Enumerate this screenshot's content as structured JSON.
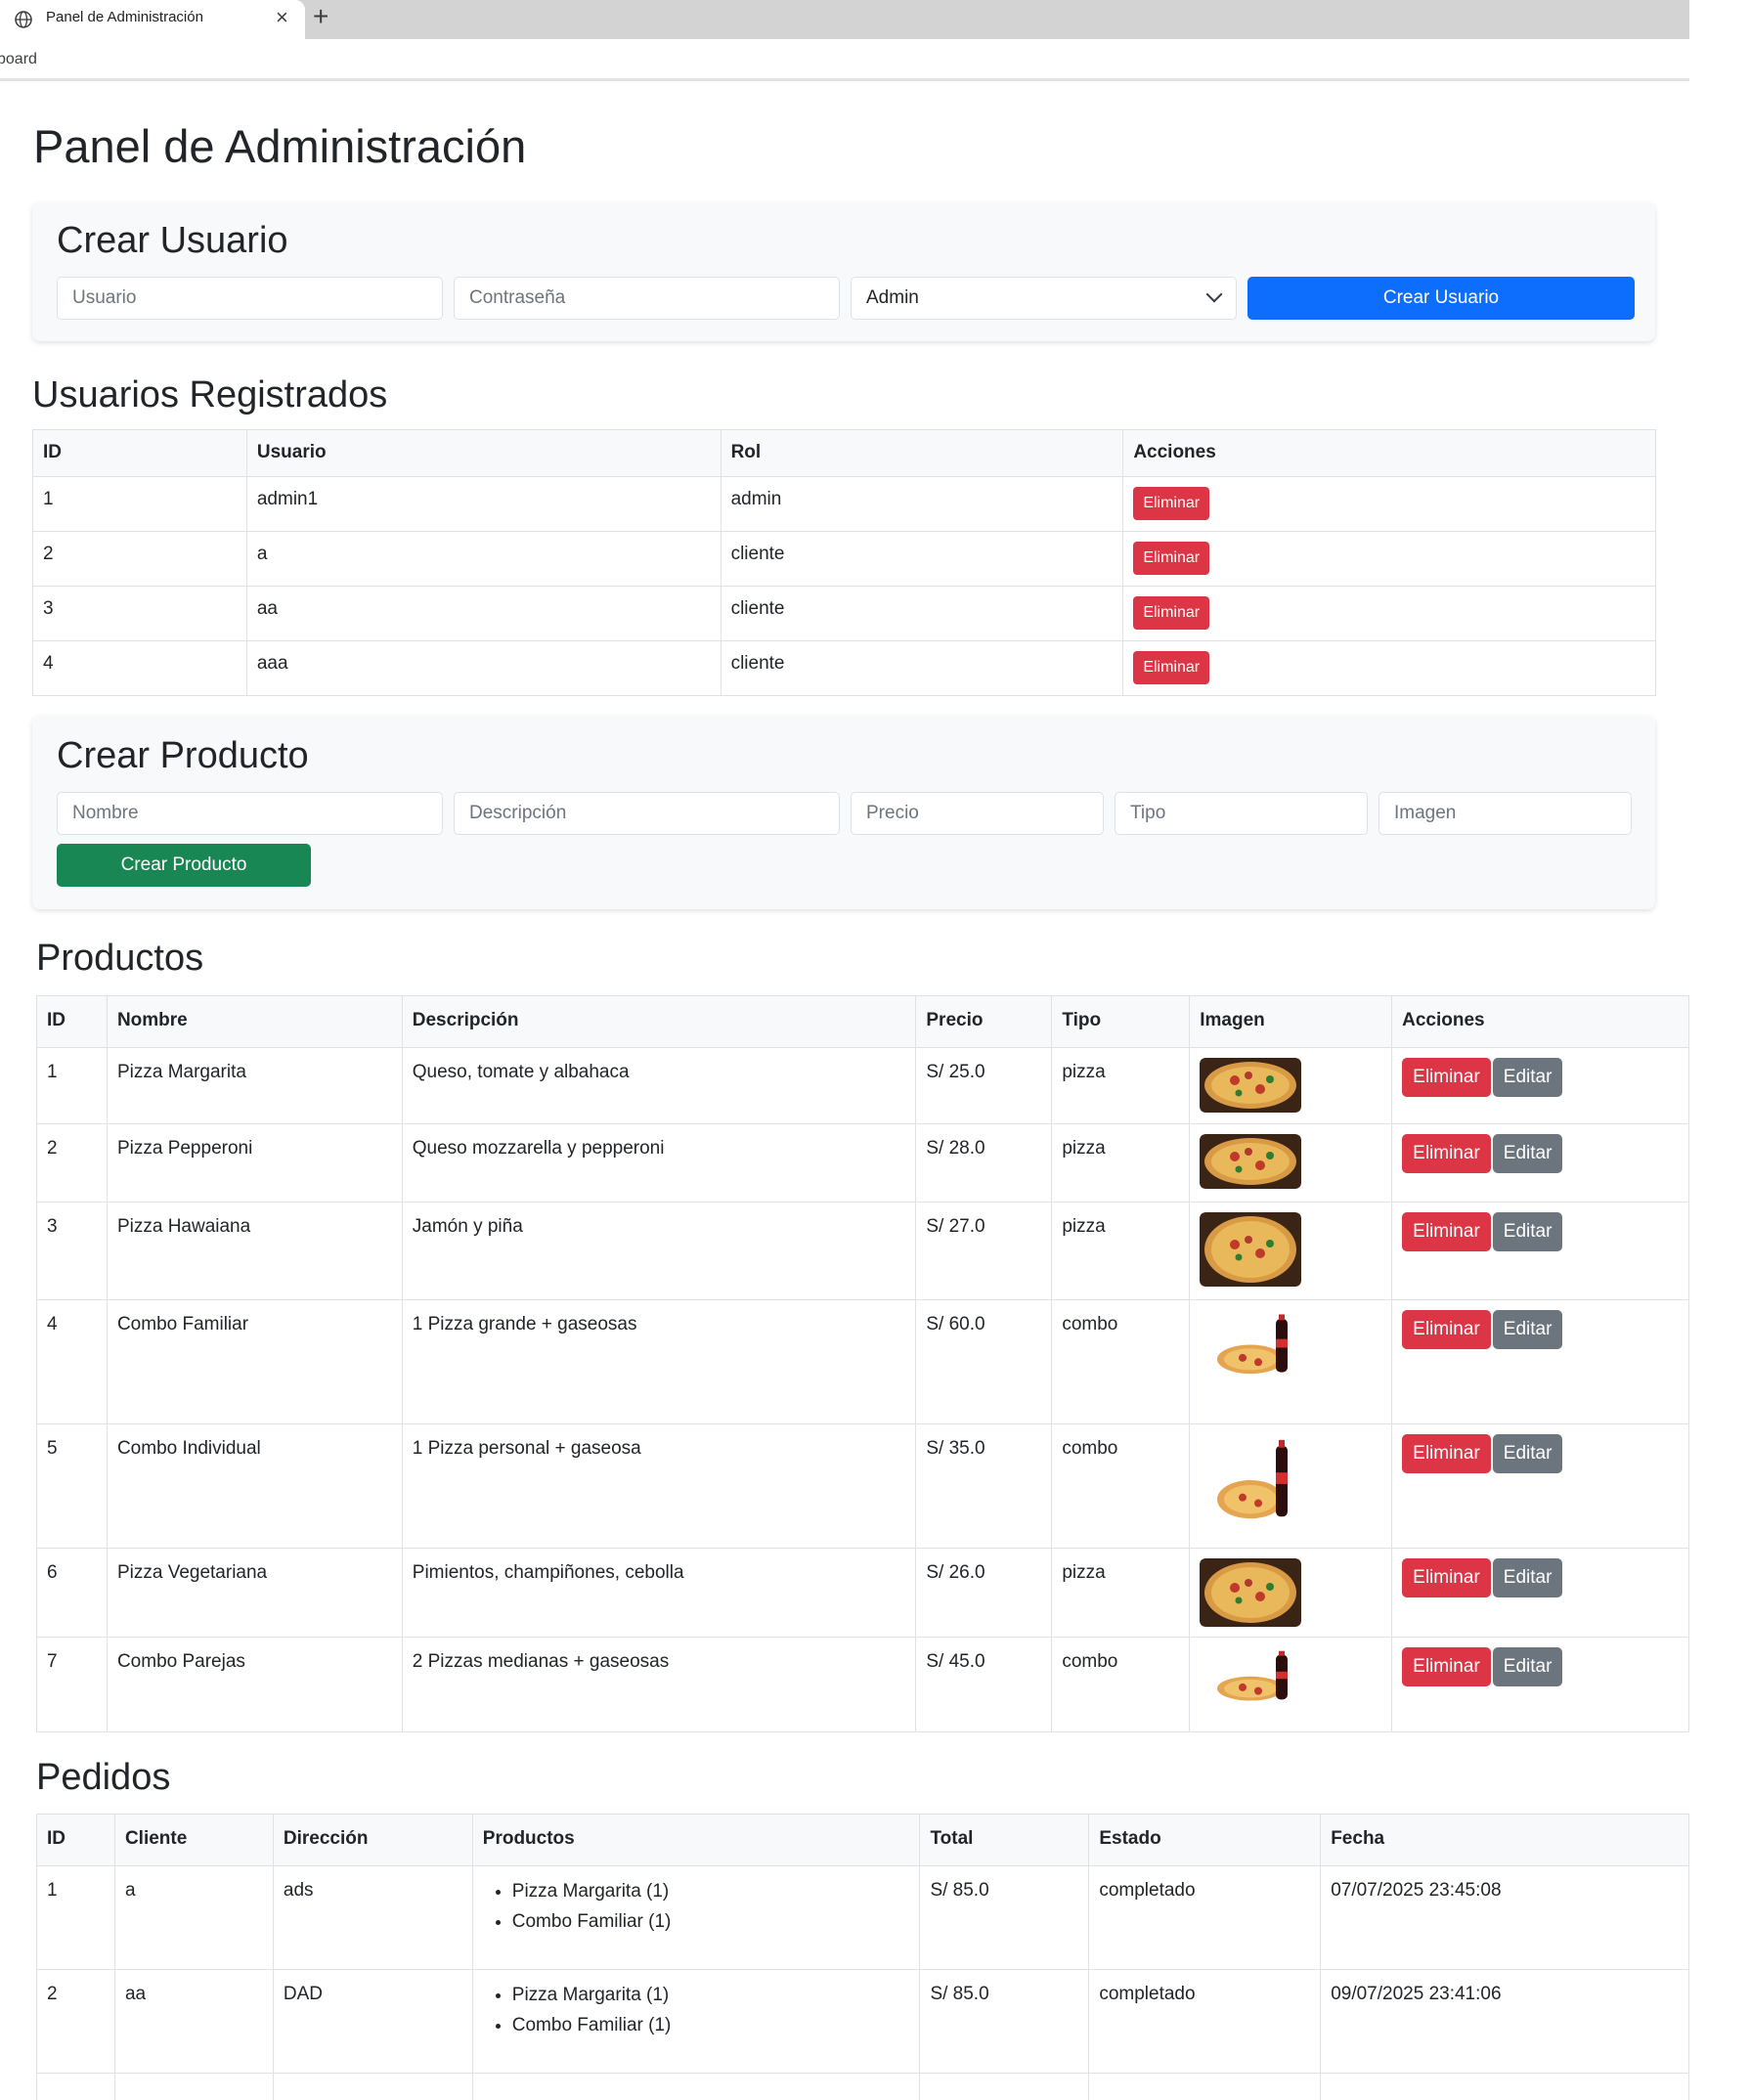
{
  "browser": {
    "tab_title": "Panel de Administración",
    "close_glyph": "×",
    "new_tab_glyph": "+",
    "url_fragment": "board"
  },
  "page": {
    "title": "Panel de Administración"
  },
  "create_user": {
    "heading": "Crear Usuario",
    "username_placeholder": "Usuario",
    "password_placeholder": "Contraseña",
    "role_selected": "Admin",
    "submit_label": "Crear Usuario"
  },
  "users": {
    "heading": "Usuarios Registrados",
    "columns": [
      "ID",
      "Usuario",
      "Rol",
      "Acciones"
    ],
    "delete_label": "Eliminar",
    "rows": [
      {
        "id": "1",
        "username": "admin1",
        "role": "admin"
      },
      {
        "id": "2",
        "username": "a",
        "role": "cliente"
      },
      {
        "id": "3",
        "username": "aa",
        "role": "cliente"
      },
      {
        "id": "4",
        "username": "aaa",
        "role": "cliente"
      }
    ]
  },
  "create_product": {
    "heading": "Crear Producto",
    "name_placeholder": "Nombre",
    "description_placeholder": "Descripción",
    "price_placeholder": "Precio",
    "type_placeholder": "Tipo",
    "image_placeholder": "Imagen",
    "submit_label": "Crear Producto"
  },
  "products": {
    "heading": "Productos",
    "columns": [
      "ID",
      "Nombre",
      "Descripción",
      "Precio",
      "Tipo",
      "Imagen",
      "Acciones"
    ],
    "delete_label": "Eliminar",
    "edit_label": "Editar",
    "rows": [
      {
        "id": "1",
        "name": "Pizza Margarita",
        "description": "Queso, tomate y albahaca",
        "price": "S/ 25.0",
        "type": "pizza",
        "image": "pizza-image"
      },
      {
        "id": "2",
        "name": "Pizza Pepperoni",
        "description": "Queso mozzarella y pepperoni",
        "price": "S/ 28.0",
        "type": "pizza",
        "image": "pizza-image"
      },
      {
        "id": "3",
        "name": "Pizza Hawaiana",
        "description": "Jamón y piña",
        "price": "S/ 27.0",
        "type": "pizza",
        "image": "pizza-image"
      },
      {
        "id": "4",
        "name": "Combo Familiar",
        "description": "1 Pizza grande + gaseosas",
        "price": "S/ 60.0",
        "type": "combo",
        "image": "combo-image"
      },
      {
        "id": "5",
        "name": "Combo Individual",
        "description": "1 Pizza personal + gaseosa",
        "price": "S/ 35.0",
        "type": "combo",
        "image": "combo-image"
      },
      {
        "id": "6",
        "name": "Pizza Vegetariana",
        "description": "Pimientos, champiñones, cebolla",
        "price": "S/ 26.0",
        "type": "pizza",
        "image": "pizza-image"
      },
      {
        "id": "7",
        "name": "Combo Parejas",
        "description": "2 Pizzas medianas + gaseosas",
        "price": "S/ 45.0",
        "type": "combo",
        "image": "combo-image"
      }
    ]
  },
  "orders": {
    "heading": "Pedidos",
    "columns": [
      "ID",
      "Cliente",
      "Dirección",
      "Productos",
      "Total",
      "Estado",
      "Fecha"
    ],
    "rows": [
      {
        "id": "1",
        "client": "a",
        "address": "ads",
        "items": [
          "Pizza Margarita (1)",
          "Combo Familiar (1)"
        ],
        "total": "S/ 85.0",
        "status": "completado",
        "date": "07/07/2025 23:45:08"
      },
      {
        "id": "2",
        "client": "aa",
        "address": "DAD",
        "items": [
          "Pizza Margarita (1)",
          "Combo Familiar (1)"
        ],
        "total": "S/ 85.0",
        "status": "completado",
        "date": "09/07/2025 23:41:06"
      }
    ]
  },
  "colors": {
    "primary": "#0d6efd",
    "success": "#198754",
    "danger": "#dc3545",
    "secondary": "#6c757d"
  }
}
